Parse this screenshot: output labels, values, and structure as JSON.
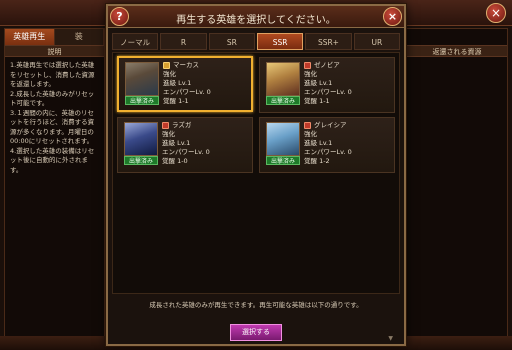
{
  "modal": {
    "title": "再生する英雄を選択してください。",
    "help_label": "?",
    "close_label": "×",
    "hint": "成長された英雄のみが再生できます。再生可能な英雄は以下の通りです。",
    "select_label": "選択する"
  },
  "rarity_tabs": [
    {
      "label": "ノーマル",
      "active": false
    },
    {
      "label": "R",
      "active": false
    },
    {
      "label": "SR",
      "active": false
    },
    {
      "label": "SSR",
      "active": true
    },
    {
      "label": "SSR+",
      "active": false
    },
    {
      "label": "UR",
      "active": false
    }
  ],
  "heroes": [
    {
      "name": "マーカス",
      "class_icon": "shield-icon",
      "status": "出撃済み",
      "line1": "強化",
      "line2": "進級 Lv.1",
      "line3": "エンパワーLv. 0",
      "line4": "覚醒 1-1",
      "selected": true
    },
    {
      "name": "ゼノビア",
      "class_icon": "sword-icon",
      "status": "出撃済み",
      "line1": "強化",
      "line2": "進級 Lv.1",
      "line3": "エンパワーLv. 0",
      "line4": "覚醒 1-1",
      "selected": false
    },
    {
      "name": "ラズガ",
      "class_icon": "sword-icon",
      "status": "出撃済み",
      "line1": "強化",
      "line2": "進級 Lv.1",
      "line3": "エンパワーLv. 0",
      "line4": "覚醒 1-0",
      "selected": false
    },
    {
      "name": "グレイシア",
      "class_icon": "sword-icon",
      "status": "出撃済み",
      "line1": "強化",
      "line2": "進級 Lv.1",
      "line3": "エンパワーLv. 0",
      "line4": "覚醒 1-2",
      "selected": false
    }
  ],
  "left_panel": {
    "tab_rebirth": "英雄再生",
    "tab_other": "装",
    "header": "説明",
    "body": "1.英雄再生では選択した英雄をリセットし、消費した資源を返還します。\n2.成長した英雄のみがリセット可能です。\n3.１週間の内に、英雄のリセットを行うほど、消費する資源が多くなります。月曜日の00:00にリセットされます。\n4.選択した英雄の装備はリセット後に自動的に外されます。"
  },
  "right_panel": {
    "header": "返還される資源"
  },
  "bg": {
    "close_label": "×"
  }
}
